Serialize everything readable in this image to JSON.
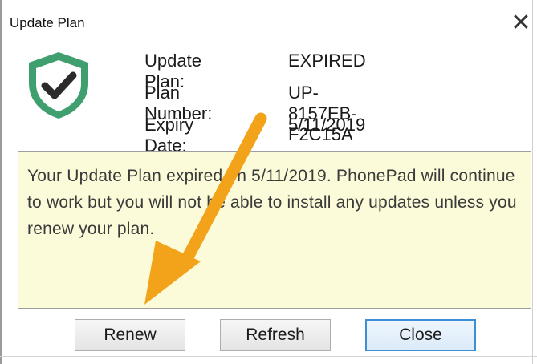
{
  "window": {
    "title": "Update Plan",
    "close_glyph": "✕"
  },
  "icon": {
    "name": "shield-check-icon",
    "color": "#3f9f6e",
    "check_color": "#2b2b2b"
  },
  "info": {
    "plan_label": "Update Plan:",
    "plan_value": "EXPIRED",
    "number_label": "Plan Number:",
    "number_value": "UP-8157EB-F2C15A",
    "expiry_label": "Expiry Date:",
    "expiry_value": "5/11/2019"
  },
  "message": "Your Update Plan expired on 5/11/2019. PhonePad will continue to work but you will not be able to install any updates unless you renew your plan.",
  "buttons": {
    "renew": "Renew",
    "refresh": "Refresh",
    "close": "Close"
  },
  "annotation": {
    "arrow_color": "#f2a31a"
  }
}
